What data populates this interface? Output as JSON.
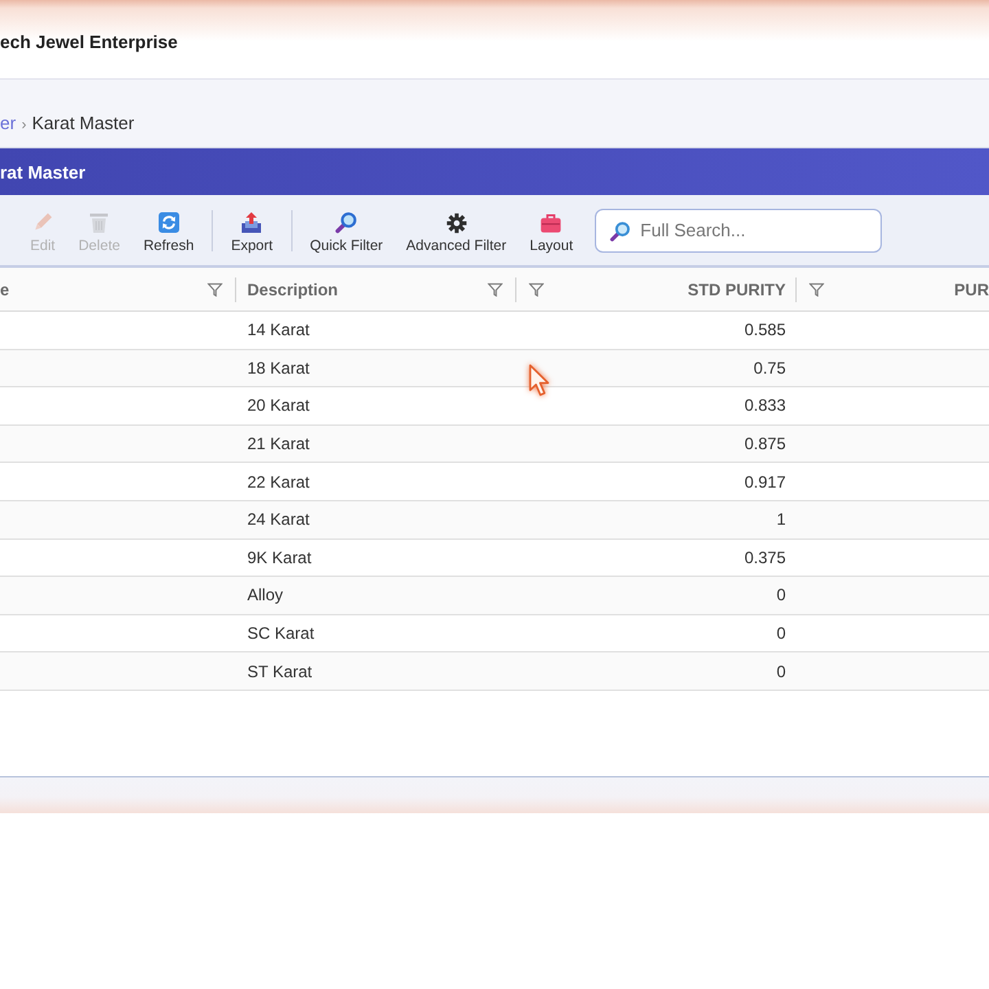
{
  "app_header": {
    "title": "ech Jewel Enterprise"
  },
  "breadcrumb": {
    "separator": "›",
    "items": [
      {
        "label": "er",
        "link": true
      },
      {
        "label": "Karat Master",
        "link": false
      }
    ]
  },
  "panel": {
    "title": "rat Master"
  },
  "toolbar": {
    "groups": [
      {
        "buttons": [
          {
            "kind": "edit",
            "label": "Edit",
            "disabled": true
          },
          {
            "kind": "delete",
            "label": "Delete",
            "disabled": true
          },
          {
            "kind": "refresh",
            "label": "Refresh",
            "disabled": false
          }
        ]
      },
      {
        "buttons": [
          {
            "kind": "export",
            "label": "Export",
            "disabled": false
          }
        ]
      },
      {
        "buttons": [
          {
            "kind": "quick_filter",
            "label": "Quick Filter",
            "disabled": false
          },
          {
            "kind": "advanced_filter",
            "label": "Advanced Filter",
            "disabled": false
          },
          {
            "kind": "layout",
            "label": "Layout",
            "disabled": false
          }
        ]
      }
    ],
    "search": {
      "placeholder": "Full Search..."
    }
  },
  "table": {
    "columns": [
      {
        "label": "e",
        "kind": "text"
      },
      {
        "label": "Description",
        "kind": "text"
      },
      {
        "label": "STD PURITY",
        "kind": "number"
      },
      {
        "label": "PUR",
        "kind": "number"
      }
    ],
    "rows": [
      {
        "description": "14 Karat",
        "std_purity": "0.585"
      },
      {
        "description": "18 Karat",
        "std_purity": "0.75"
      },
      {
        "description": "20 Karat",
        "std_purity": "0.833"
      },
      {
        "description": "21 Karat",
        "std_purity": "0.875"
      },
      {
        "description": "22 Karat",
        "std_purity": "0.917"
      },
      {
        "description": "24 Karat",
        "std_purity": "1"
      },
      {
        "description": "9K Karat",
        "std_purity": "0.375"
      },
      {
        "description": "Alloy",
        "std_purity": "0"
      },
      {
        "description": "SC Karat",
        "std_purity": "0"
      },
      {
        "description": "ST Karat",
        "std_purity": "0"
      }
    ]
  }
}
